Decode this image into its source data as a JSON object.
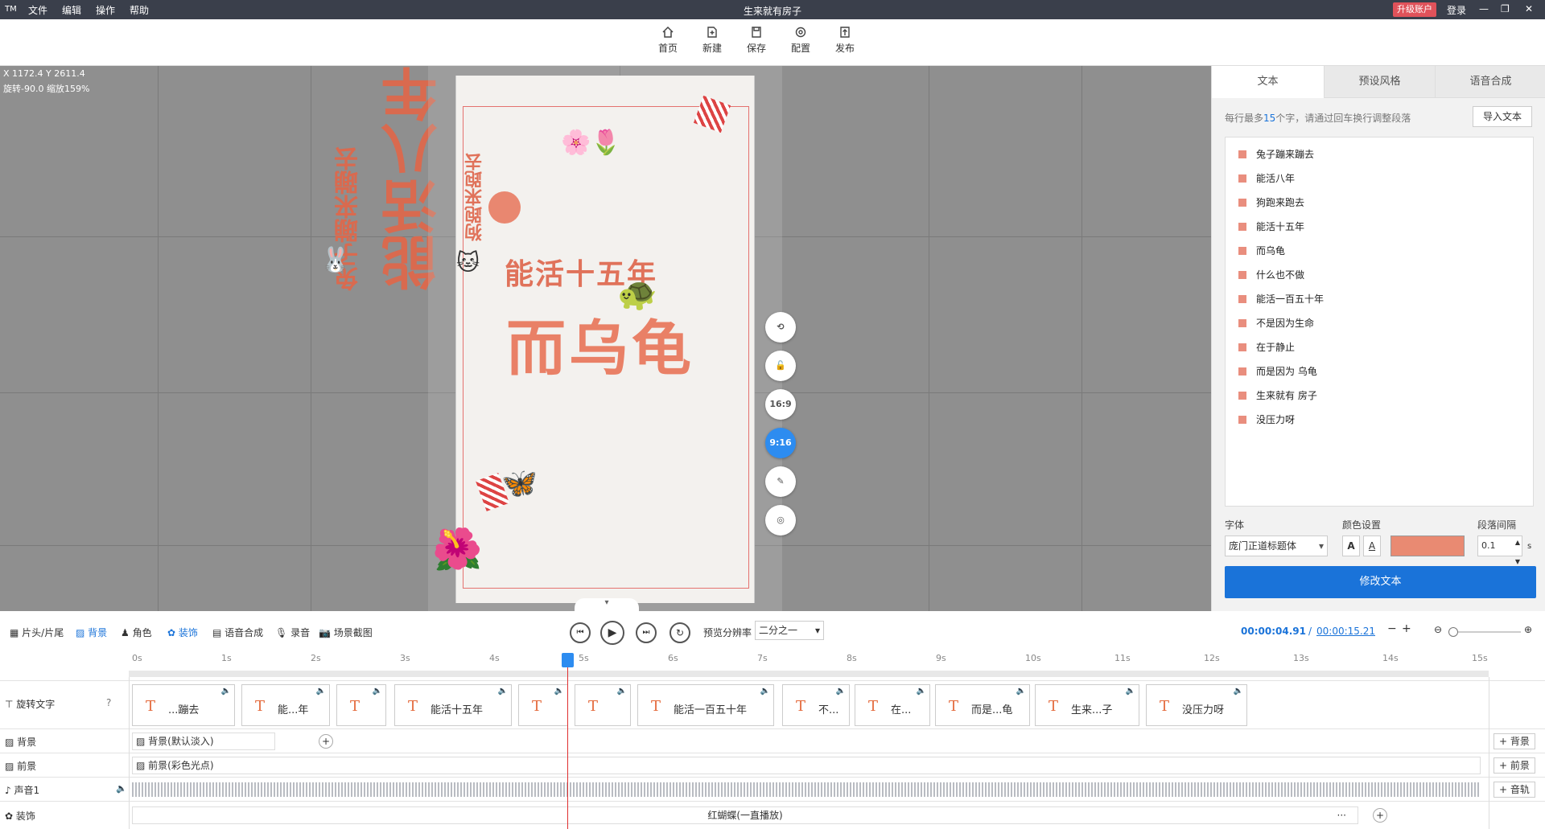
{
  "app": {
    "title": "生来就有房子",
    "logo": "TM",
    "menu": [
      "文件",
      "编辑",
      "操作",
      "帮助"
    ],
    "upgrade": "升级账户",
    "login": "登录"
  },
  "toolbar": [
    {
      "label": "首页",
      "icon": "home-icon"
    },
    {
      "label": "新建",
      "icon": "new-icon"
    },
    {
      "label": "保存",
      "icon": "save-icon"
    },
    {
      "label": "配置",
      "icon": "gear-icon"
    },
    {
      "label": "发布",
      "icon": "publish-icon"
    }
  ],
  "canvas": {
    "coords": "X 1172.4  Y 2611.4",
    "rotation": "旋转-90.0  缩放159%",
    "texts": {
      "rabbit": "兔子蹦来蹦去",
      "eight": "能活八年",
      "dog": "狗跑来跑去",
      "fifteen": "能活十五年",
      "turtle": "而乌龟"
    },
    "ratio_169": "16:9",
    "ratio_916": "9:16"
  },
  "panel": {
    "tabs": [
      "文本",
      "预设风格",
      "语音合成"
    ],
    "hint_a": "每行最多",
    "hint_num": "15",
    "hint_b": "个字，请通过回车换行调整段落",
    "import": "导入文本",
    "lines": [
      "兔子蹦来蹦去",
      "能活八年",
      "狗跑来跑去",
      "能活十五年",
      "而乌龟",
      "什么也不做",
      "能活一百五十年",
      "不是因为生命",
      "在于静止",
      "而是因为  乌龟",
      "生来就有   房子",
      "没压力呀"
    ],
    "font_label": "字体",
    "font_value": "庞门正道标题体",
    "color_label": "颜色设置",
    "color": "#e98a72",
    "spacing_label": "段落间隔",
    "spacing_value": "0.1",
    "spacing_unit": "s",
    "submit": "修改文本"
  },
  "bottom": {
    "tools": [
      "片头/片尾",
      "背景",
      "角色",
      "装饰",
      "语音合成",
      "录音",
      "场景截图"
    ],
    "preview_label": "预览分辨率",
    "preview_value": "二分之一",
    "time_current": "00:00:04.91",
    "time_sep": "/",
    "time_total": "00:00:15.21"
  },
  "ruler": [
    "0s",
    "1s",
    "2s",
    "3s",
    "4s",
    "5s",
    "6s",
    "7s",
    "8s",
    "9s",
    "10s",
    "11s",
    "12s",
    "13s",
    "14s",
    "15s"
  ],
  "tracks": {
    "text_label": "旋转文字",
    "bg_label": "背景",
    "fg_label": "前景",
    "audio_label": "声音1",
    "deco_label": "装饰",
    "clips": [
      "...蹦去",
      "能...年",
      "",
      "能活十五年",
      "",
      "",
      "能活一百五十年",
      "不...",
      "在...",
      "而是...龟",
      "生来...子",
      "没压力呀"
    ],
    "bg_clip": "背景(默认淡入)",
    "fg_clip": "前景(彩色光点)",
    "deco_clip": "红蝴蝶(一直播放)",
    "deco_more": "···",
    "add_bg": "+ 背景",
    "add_fg": "+ 前景",
    "add_audio": "+ 音轨"
  }
}
